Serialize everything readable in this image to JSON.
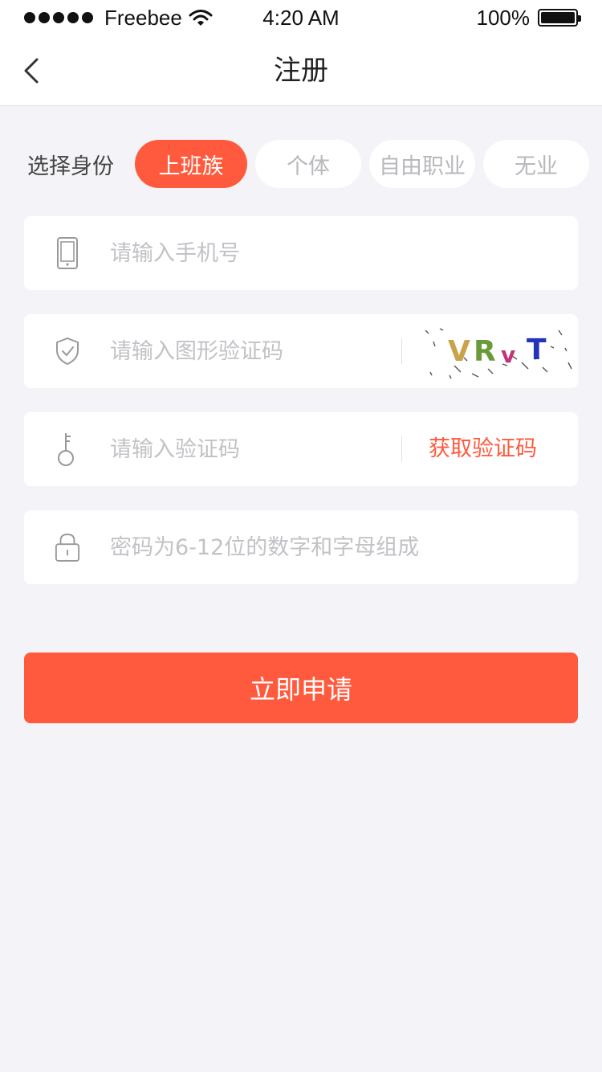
{
  "status_bar": {
    "carrier": "Freebee",
    "time": "4:20 AM",
    "battery": "100%"
  },
  "nav": {
    "title": "注册"
  },
  "identity": {
    "label": "选择身份",
    "options": [
      {
        "label": "上班族",
        "active": true
      },
      {
        "label": "个体",
        "active": false
      },
      {
        "label": "自由职业",
        "active": false
      },
      {
        "label": "无业",
        "active": false
      }
    ]
  },
  "form": {
    "phone_placeholder": "请输入手机号",
    "captcha_placeholder": "请输入图形验证码",
    "captcha_text": "VRvT",
    "code_placeholder": "请输入验证码",
    "get_code_label": "获取验证码",
    "password_placeholder": "密码为6-12位的数字和字母组成"
  },
  "submit": {
    "label": "立即申请"
  },
  "colors": {
    "accent": "#ff5a3d",
    "background": "#f4f4f8",
    "placeholder": "#c2c2c7"
  }
}
